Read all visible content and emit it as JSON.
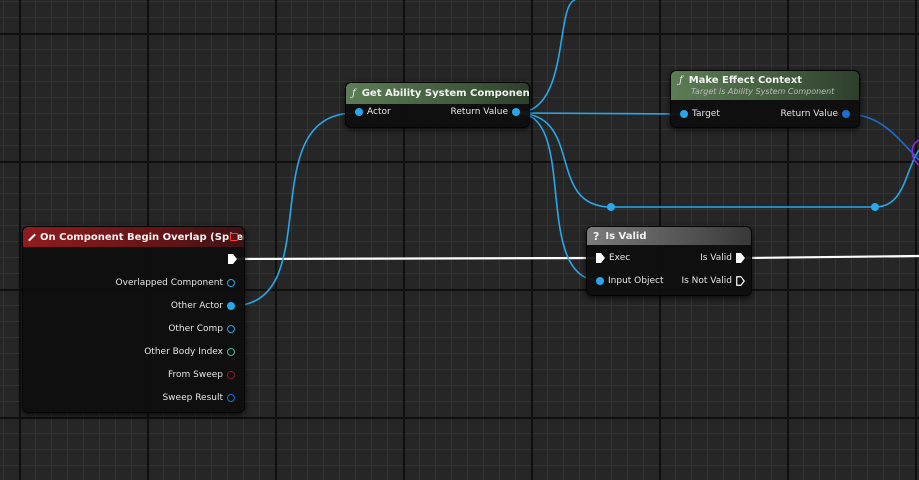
{
  "nodes": {
    "get_asc": {
      "title": "Get Ability System Component",
      "icon": "function-icon",
      "input_pin": "Actor",
      "output_pin": "Return Value",
      "header_color": "#4a6a45"
    },
    "make_ctx": {
      "title": "Make Effect Context",
      "subtitle": "Target is Ability System Component",
      "icon": "function-icon",
      "input_pin": "Target",
      "output_pin": "Return Value",
      "header_color": "#4a6a45"
    },
    "is_valid": {
      "title": "Is Valid",
      "icon": "macro-icon",
      "icon_glyph": "?",
      "exec_in": "Exec",
      "object_in": "Input Object",
      "valid_out": "Is Valid",
      "not_valid_out": "Is Not Valid",
      "header_color": "#666666"
    },
    "overlap_event": {
      "title": "On Component Begin Overlap (Sphere)",
      "icon": "event-icon",
      "header_color": "#7d1a1c",
      "pins": [
        {
          "label": "Overlapped Component",
          "type": "object"
        },
        {
          "label": "Other Actor",
          "type": "object",
          "connected": true
        },
        {
          "label": "Other Comp",
          "type": "object"
        },
        {
          "label": "Other Body Index",
          "type": "integer"
        },
        {
          "label": "From Sweep",
          "type": "boolean"
        },
        {
          "label": "Sweep Result",
          "type": "struct"
        }
      ]
    }
  },
  "colors": {
    "object_wire": "#28a8ea",
    "exec_wire": "#ffffff",
    "object_wire_dark": "#1a6fd3",
    "purple_wire": "#8a2be2"
  }
}
